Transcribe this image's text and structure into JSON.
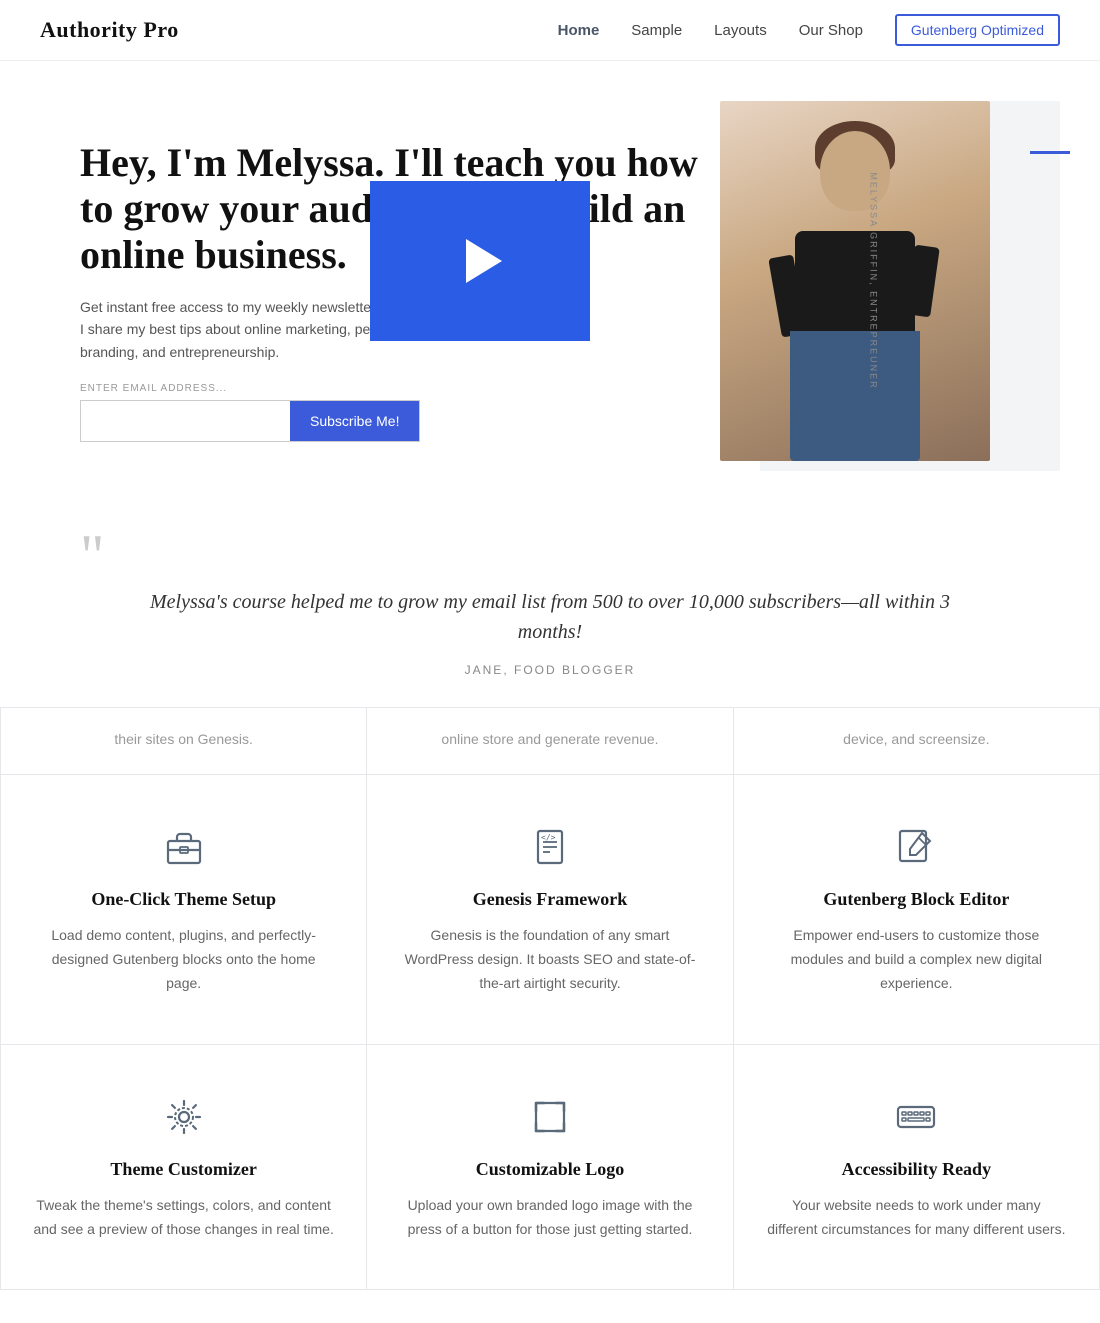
{
  "header": {
    "logo": "Authority Pro",
    "nav": {
      "links": [
        {
          "label": "Home",
          "active": true
        },
        {
          "label": "Sample",
          "active": false
        },
        {
          "label": "Layouts",
          "active": false
        },
        {
          "label": "Our Shop",
          "active": false
        }
      ],
      "cta": "Gutenberg Optimized"
    }
  },
  "hero": {
    "title": "Hey, I'm Melyssa. I'll teach you how to grow your audience and build an online business.",
    "subtitle": "Get instant free access to my weekly newsletter where I share my best tips about online marketing, personal branding, and entrepreneurship.",
    "email_label": "Enter email address...",
    "subscribe_btn": "Subscribe Me!",
    "side_text": "MELYSSA GRIFFIN, ENTREPREUNER"
  },
  "testimonial": {
    "quote": "Melyssa's course helped me to grow my email list from 500 to over 10,000 subscribers—all within 3 months!",
    "author": "Jane, Food Blogger"
  },
  "partial_row": [
    {
      "text": "their sites on Genesis."
    },
    {
      "text": "online store and generate revenue."
    },
    {
      "text": "device, and screensize."
    }
  ],
  "features": [
    {
      "icon": "briefcase",
      "title": "One-Click Theme Setup",
      "desc": "Load demo content, plugins, and perfectly-designed Gutenberg blocks onto the home page."
    },
    {
      "icon": "code",
      "title": "Genesis Framework",
      "desc": "Genesis is the foundation of any smart WordPress design. It boasts SEO and state-of-the-art airtight security."
    },
    {
      "icon": "edit",
      "title": "Gutenberg Block Editor",
      "desc": "Empower end-users to customize those modules and build a complex new digital experience."
    },
    {
      "icon": "gear",
      "title": "Theme Customizer",
      "desc": "Tweak the theme's settings, colors, and content and see a preview of those changes in real time."
    },
    {
      "icon": "resize",
      "title": "Customizable Logo",
      "desc": "Upload your own branded logo image with the press of a button for those just getting started."
    },
    {
      "icon": "keyboard",
      "title": "Accessibility Ready",
      "desc": "Your website needs to work under many different circumstances for many different users."
    }
  ]
}
